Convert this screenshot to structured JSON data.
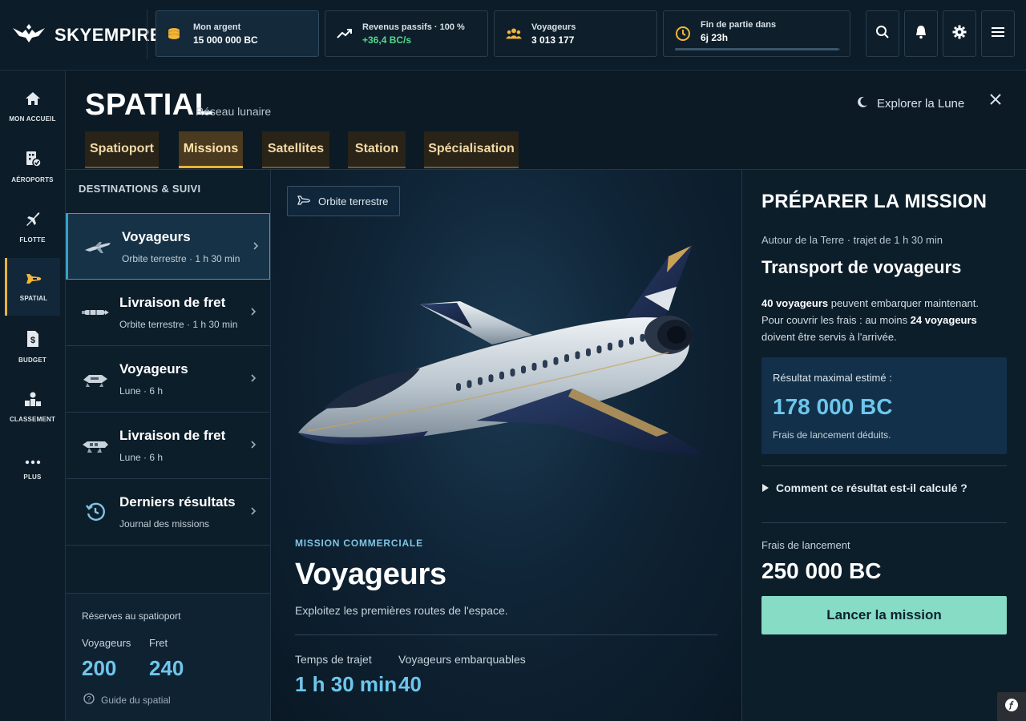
{
  "app": {
    "title": "SKYEMPIRE"
  },
  "topbar": {
    "stats": [
      {
        "label": "Mon argent",
        "value": "15 000 000 BC",
        "icon": "coins-icon"
      },
      {
        "label": "Revenus passifs · 100 %",
        "value": "+36,4 BC/s",
        "icon": "trend-up-icon"
      },
      {
        "label": "Voyageurs",
        "value": "3 013 177",
        "icon": "users-icon"
      },
      {
        "label": "Fin de partie dans",
        "value": "6j 23h",
        "icon": "clock-icon"
      }
    ],
    "endgame_progress": 0.99,
    "buttons": [
      "search-icon",
      "bell-icon",
      "gear-icon",
      "menu-icon"
    ]
  },
  "rail": {
    "items": [
      {
        "label": "MON ACCUEIL"
      },
      {
        "label": "AÉROPORTS"
      },
      {
        "label": "FLOTTE"
      },
      {
        "label": "SPATIAL"
      },
      {
        "label": "BUDGET"
      },
      {
        "label": "CLASSEMENT"
      },
      {
        "label": "PLUS"
      }
    ]
  },
  "header": {
    "title": "SPATIAL",
    "subtitle": "Réseau lunaire",
    "explore": "Explorer la Lune",
    "tabs": [
      "Spatioport",
      "Missions",
      "Satellites",
      "Station",
      "Spécialisation"
    ]
  },
  "destinations": {
    "heading": "DESTINATIONS & SUIVI",
    "items": [
      {
        "title": "Voyageurs",
        "sub": "Orbite terrestre · 1 h 30 min"
      },
      {
        "title": "Livraison de fret",
        "sub": "Orbite terrestre · 1 h 30 min"
      },
      {
        "title": "Voyageurs",
        "sub": "Lune · 6 h"
      },
      {
        "title": "Livraison de fret",
        "sub": "Lune · 6 h"
      },
      {
        "title": "Derniers résultats",
        "sub": "Journal des missions"
      }
    ],
    "reserves": {
      "title": "Réserves au spatioport",
      "voyageurs_label": "Voyageurs",
      "voyageurs_value": "200",
      "fret_label": "Fret",
      "fret_value": "240",
      "guide": "Guide du spatial"
    }
  },
  "hero": {
    "chip": "Orbite terrestre",
    "kicker": "MISSION COMMERCIALE",
    "title": "Voyageurs",
    "desc": "Exploitez les premières routes de l'espace.",
    "stat1_label": "Temps de trajet",
    "stat1_value": "1 h 30 min",
    "stat2_label": "Voyageurs embarquables",
    "stat2_value": "40"
  },
  "prep": {
    "title": "PRÉPARER LA MISSION",
    "sub": "Autour de la Terre · trajet de 1 h 30 min",
    "heading": "Transport de voyageurs",
    "p_b1": "40 voyageurs",
    "p_t1": " peuvent embarquer maintenant.",
    "p_t2": "Pour couvrir les frais : au moins ",
    "p_b2": "24 voyageurs",
    "p_t3": "doivent être servis à l'arrivée.",
    "result_label": "Résultat maximal estimé :",
    "result_value": "178 000 BC",
    "result_note": "Frais de lancement déduits.",
    "how": "Comment ce résultat est-il calculé ?",
    "fees_label": "Frais de lancement",
    "fees_value": "250 000 BC",
    "launch": "Lancer la mission"
  }
}
